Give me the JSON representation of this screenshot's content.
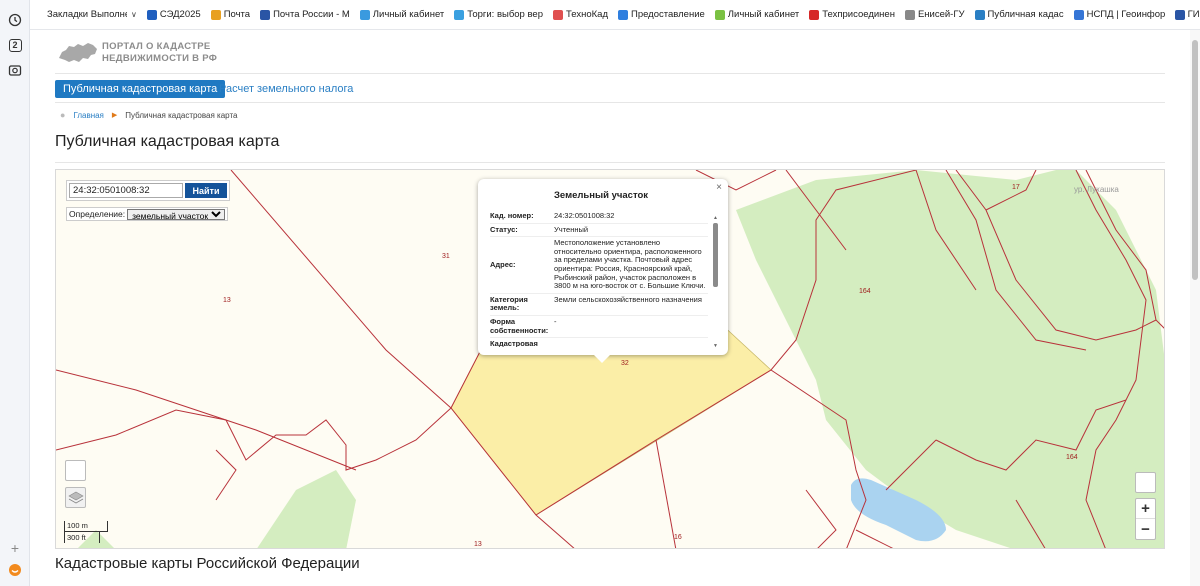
{
  "bookmarks": [
    {
      "label": "Закладки Выполнен",
      "color": "#ffffff",
      "has_chevron": true
    },
    {
      "label": "СЭД2025",
      "color": "#1f5fbf"
    },
    {
      "label": "Почта",
      "color": "#e8a020"
    },
    {
      "label": "Почта России - М",
      "color": "#2a55a5"
    },
    {
      "label": "Личный кабинет",
      "color": "#3a9adf"
    },
    {
      "label": "Торги: выбор вер",
      "color": "#3aa0e0"
    },
    {
      "label": "ТехноКад",
      "color": "#e05050"
    },
    {
      "label": "Предоставление",
      "color": "#2f7fdf"
    },
    {
      "label": "Личный кабинет",
      "color": "#7ac142"
    },
    {
      "label": "Техприсоединен",
      "color": "#d62828"
    },
    {
      "label": "Енисей-ГУ",
      "color": "#888888"
    },
    {
      "label": "Публичная кадас",
      "color": "#2a7fc4"
    },
    {
      "label": "НСПД | Геоинфор",
      "color": "#3575d6"
    },
    {
      "label": "ГИСОГД Красноя",
      "color": "#2a55a5"
    }
  ],
  "site": {
    "logo_line1": "ПОРТАЛ О КАДАСТРЕ",
    "logo_line2": "НЕДВИЖИМОСТИ В РФ"
  },
  "nav": {
    "active_tab": "Публичная кадастровая карта",
    "link_tab": "Расчет земельного налога"
  },
  "breadcrumb": {
    "home": "Главная",
    "current": "Публичная кадастровая карта"
  },
  "page_title": "Публичная кадастровая карта",
  "map": {
    "search_value": "24:32:0501008:32",
    "search_button": "Найти",
    "define_label": "Определение:",
    "define_value": "земельный участок",
    "scale_m": "100 m",
    "scale_ft": "300 ft",
    "street": "ур. Лукашка",
    "labels": [
      "31",
      "13",
      "17",
      "164",
      "164",
      "32",
      "13",
      "16"
    ]
  },
  "popup": {
    "title": "Земельный участок",
    "close": "×",
    "rows": [
      {
        "key": "Кад. номер:",
        "value": "24:32:0501008:32"
      },
      {
        "key": "Статус:",
        "value": "Учтенный"
      },
      {
        "key": "Адрес:",
        "value": "Местоположение установлено относительно ориентира, расположенного за пределами участка. Почтовый адрес ориентира: Россия, Красноярский край, Рыбинский район, участок расположен в 3800 м на юго-восток от с. Большие Ключи."
      },
      {
        "key": "Категория земель:",
        "value": "Земли сельскохозяйственного назначения"
      },
      {
        "key": "Форма собственности:",
        "value": "-"
      },
      {
        "key": "Кадастровая",
        "value": ""
      }
    ]
  },
  "section_title": "Кадастровые карты Российской Федерации"
}
